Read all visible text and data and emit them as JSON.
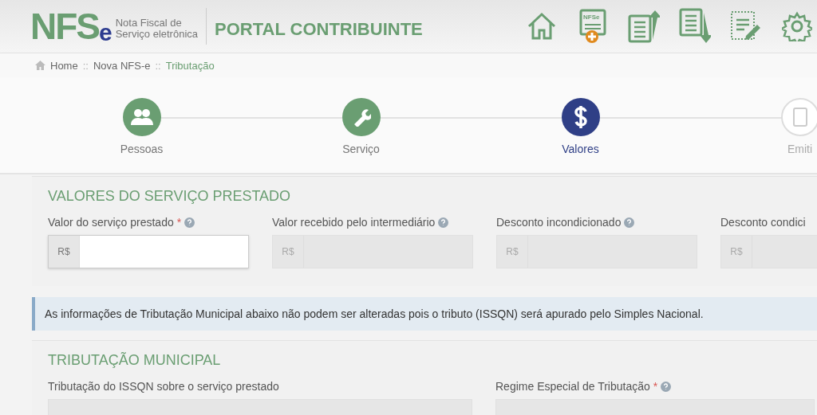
{
  "header": {
    "logo": {
      "main": "NFS",
      "suffix": "e"
    },
    "tagline": [
      "Nota Fiscal de",
      "Serviço eletrônica"
    ],
    "title": "PORTAL CONTRIBUINTE",
    "toolbar": [
      {
        "kind": "home"
      },
      {
        "kind": "new",
        "label": "NFSe"
      },
      {
        "kind": "upload"
      },
      {
        "kind": "download"
      },
      {
        "kind": "edit"
      },
      {
        "kind": "settings"
      }
    ]
  },
  "breadcrumb": [
    {
      "label": "Home",
      "selected": false
    },
    {
      "label": "Nova NFS-e",
      "selected": false
    },
    {
      "label": "Tributação",
      "selected": true
    }
  ],
  "breadcrumb_separator": "::",
  "steps": [
    {
      "label": "Pessoas",
      "kind": "people",
      "done": true,
      "selected": false
    },
    {
      "label": "Serviço",
      "kind": "wrench",
      "done": true,
      "selected": false
    },
    {
      "label": "Valores",
      "kind": "dollar",
      "selected": true
    },
    {
      "label": "Emiti",
      "kind": "document",
      "done": false,
      "selected": false
    }
  ],
  "values_section": {
    "title": "VALORES DO SERVIÇO PRESTADO",
    "fields": [
      {
        "label": "Valor do serviço prestado",
        "required_mark": "*",
        "help": true,
        "prefix": "R$",
        "disabled": false
      },
      {
        "label": "Valor recebido pelo intermediário",
        "help": true,
        "prefix": "R$",
        "disabled": true
      },
      {
        "label": "Desconto incondicionado",
        "help": true,
        "prefix": "R$",
        "disabled": true
      },
      {
        "label": "Desconto condici",
        "help": false,
        "prefix": "R$",
        "disabled": true
      }
    ]
  },
  "alert": "As informações de Tributação Municipal abaixo não podem ser alteradas pois o tributo (ISSQN) será apurado pelo Simples Nacional.",
  "tax_section": {
    "title": "TRIBUTAÇÃO MUNICIPAL",
    "fields": [
      {
        "label": "Tributação do ISSQN sobre o serviço prestado",
        "help": false,
        "disabled": true
      },
      {
        "label": "Regime Especial de Tributação",
        "required_mark": "*",
        "help": true,
        "disabled": true
      }
    ]
  }
}
